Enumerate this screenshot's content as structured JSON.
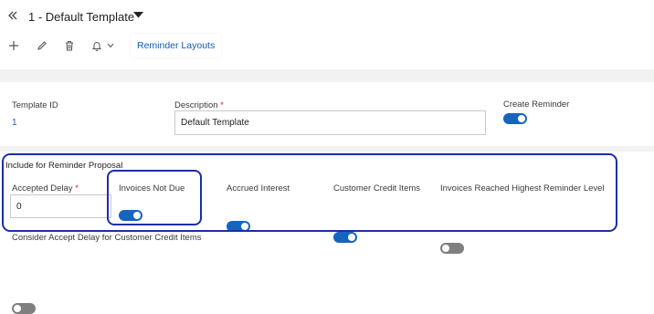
{
  "header": {
    "title": "1 - Default Template"
  },
  "toolbar": {
    "tab_label": "Reminder Layouts"
  },
  "form": {
    "template_id_label": "Template ID",
    "template_id_value": "1",
    "description_label": "Description",
    "description_required_mark": "*",
    "description_value": "Default Template",
    "create_reminder_label": "Create Reminder",
    "create_reminder_on": true
  },
  "proposal": {
    "section_title": "Include for Reminder Proposal",
    "accepted_delay_label": "Accepted Delay",
    "accepted_delay_required_mark": "*",
    "accepted_delay_value": "0",
    "invoices_not_due_label": "Invoices Not Due",
    "invoices_not_due_on": true,
    "accrued_interest_label": "Accrued Interest",
    "accrued_interest_on": true,
    "customer_credit_items_label": "Customer Credit Items",
    "customer_credit_items_on": true,
    "highest_level_label": "Invoices Reached Highest Reminder Level",
    "highest_level_on": false,
    "consider_delay_label": "Consider Accept Delay for Customer Credit Items",
    "consider_delay_on": false
  },
  "colors": {
    "accent": "#1565c0",
    "link": "#0f62b5",
    "annotation_outline": "#1a2fa8"
  }
}
